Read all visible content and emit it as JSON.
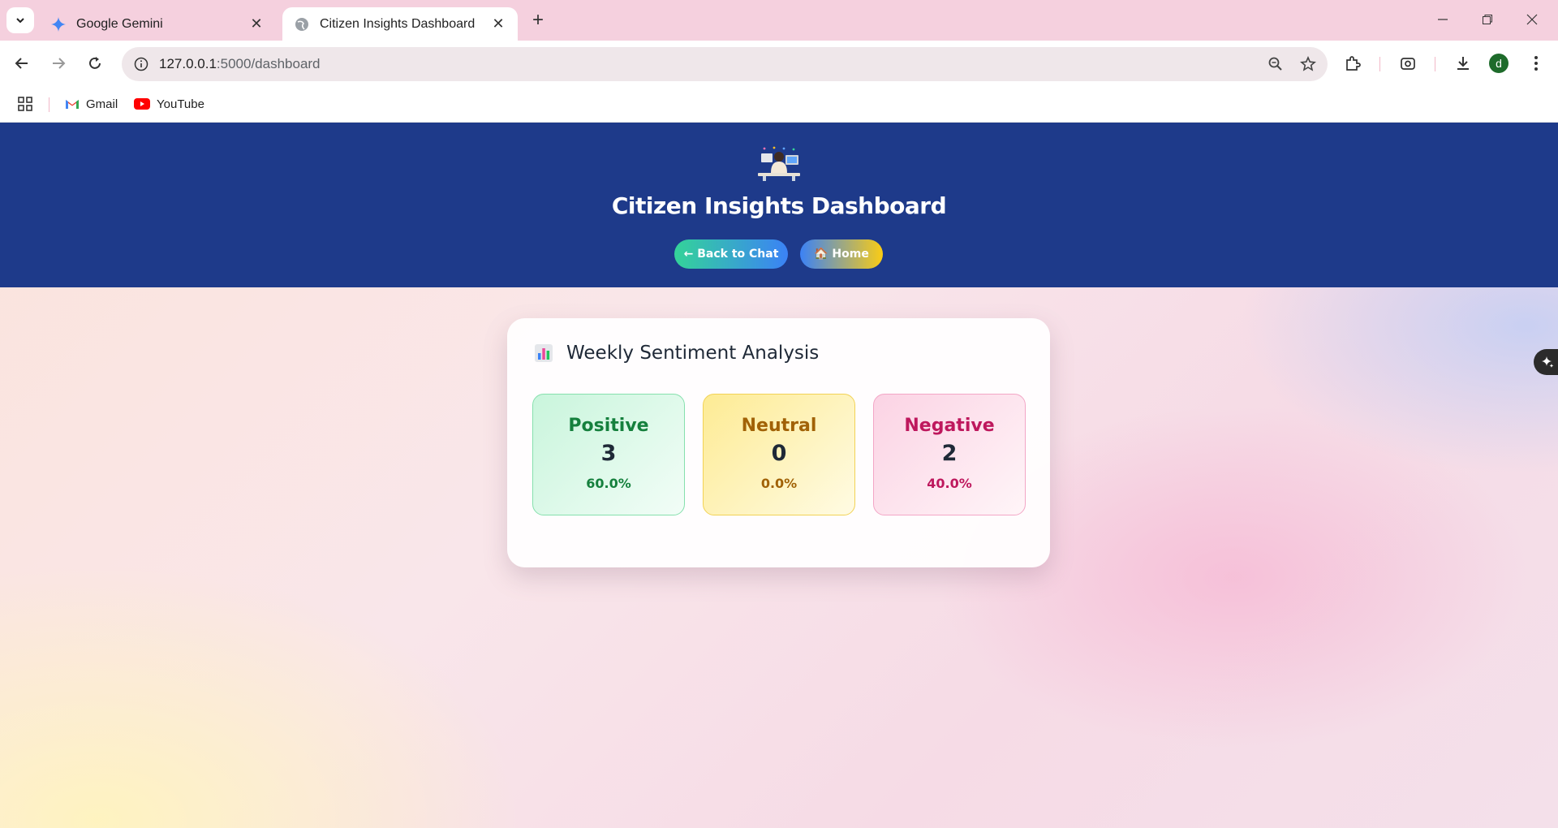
{
  "browser": {
    "tabs": [
      {
        "title": "Google Gemini",
        "icon": "gemini-icon",
        "active": false
      },
      {
        "title": "Citizen Insights Dashboard",
        "icon": "globe-icon",
        "active": true
      }
    ],
    "url_host": "127.0.0.1",
    "url_path": ":5000/dashboard",
    "avatar_letter": "d",
    "bookmarks": [
      {
        "label": "Gmail",
        "icon": "gmail-icon"
      },
      {
        "label": "YouTube",
        "icon": "youtube-icon"
      }
    ]
  },
  "header": {
    "title": "Citizen Insights Dashboard",
    "back_button": "← Back to Chat",
    "home_button": "🏠 Home",
    "colors": {
      "background": "#1e3a8a"
    }
  },
  "sentiment": {
    "title": "Weekly Sentiment Analysis",
    "icon": "bar-chart-icon",
    "positive": {
      "label": "Positive",
      "count": "3",
      "percent": "60.0%",
      "color": "#15803d"
    },
    "neutral": {
      "label": "Neutral",
      "count": "0",
      "percent": "0.0%",
      "color": "#a16207"
    },
    "negative": {
      "label": "Negative",
      "count": "2",
      "percent": "40.0%",
      "color": "#be185d"
    }
  }
}
